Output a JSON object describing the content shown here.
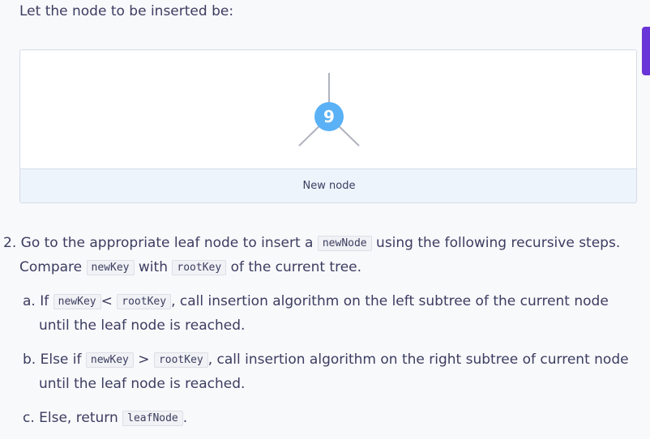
{
  "intro": "Let the node to be inserted be:",
  "figure": {
    "node_value": "9",
    "caption": "New node",
    "node_color": "#5ab1f5",
    "edge_color": "#b0b3bd"
  },
  "step2": {
    "number": "2.",
    "part1": "Go to the appropriate leaf node to insert a",
    "code_newnode": "newNode",
    "part2": "using the following recursive steps.",
    "part3": "Compare",
    "code_newkey": "newKey",
    "part4": "with",
    "code_rootkey": "rootKey",
    "part5": "of the current tree."
  },
  "step_a": {
    "label": "a. If",
    "code_newkey": "newKey",
    "operator": "<",
    "code_rootkey": "rootKey",
    "text1": ", call insertion algorithm on the left subtree of the current node",
    "text2": "until the leaf node is reached."
  },
  "step_b": {
    "label": "b. Else if",
    "code_newkey": "newKey",
    "operator": ">",
    "code_rootkey": "rootKey",
    "text1": ", call insertion algorithm on the right subtree of current node",
    "text2": "until the leaf node is reached."
  },
  "step_c": {
    "label": "c. Else, return",
    "code_leafnode": "leafNode",
    "end": "."
  }
}
